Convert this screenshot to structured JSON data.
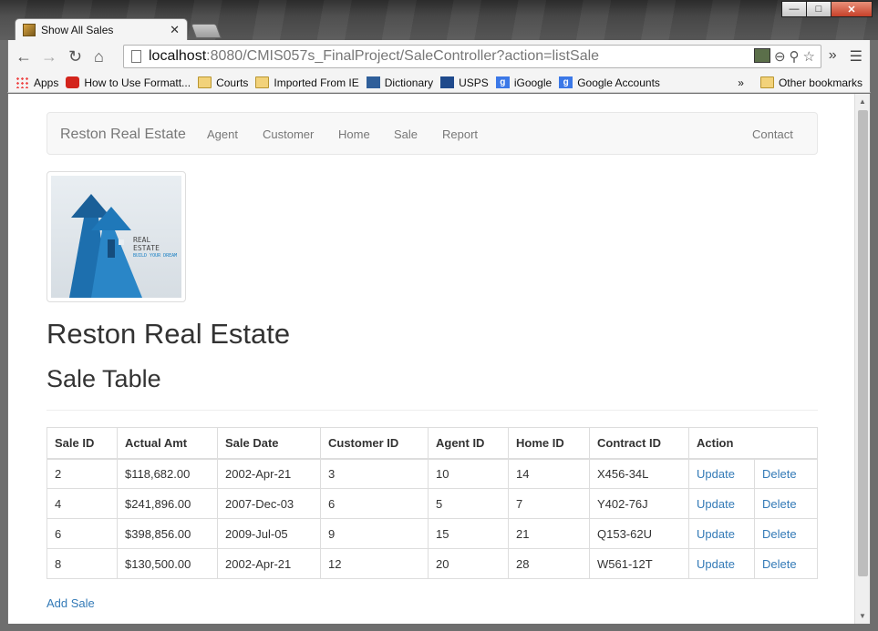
{
  "browser": {
    "tab_title": "Show All Sales",
    "url_host": "localhost",
    "url_rest": ":8080/CMIS057s_FinalProject/SaleController?action=listSale",
    "bookmarks": [
      "Apps",
      "How to Use Formatt...",
      "Courts",
      "Imported From IE",
      "Dictionary",
      "USPS",
      "iGoogle",
      "Google Accounts"
    ],
    "other_bookmarks": "Other bookmarks",
    "overflow": "»"
  },
  "navbar": {
    "brand": "Reston Real Estate",
    "links": [
      "Agent",
      "Customer",
      "Home",
      "Sale",
      "Report"
    ],
    "contact": "Contact"
  },
  "logo": {
    "line1": "REAL",
    "line2": "ESTATE",
    "line3": "BUILD YOUR DREAM"
  },
  "page": {
    "title": "Reston Real Estate",
    "subtitle": "Sale Table",
    "add_link": "Add Sale"
  },
  "table": {
    "headers": [
      "Sale ID",
      "Actual Amt",
      "Sale Date",
      "Customer ID",
      "Agent ID",
      "Home ID",
      "Contract ID",
      "Action"
    ],
    "rows": [
      [
        "2",
        "$118,682.00",
        "2002-Apr-21",
        "3",
        "10",
        "14",
        "X456-34L"
      ],
      [
        "4",
        "$241,896.00",
        "2007-Dec-03",
        "6",
        "5",
        "7",
        "Y402-76J"
      ],
      [
        "6",
        "$398,856.00",
        "2009-Jul-05",
        "9",
        "15",
        "21",
        "Q153-62U"
      ],
      [
        "8",
        "$130,500.00",
        "2002-Apr-21",
        "12",
        "20",
        "28",
        "W561-12T"
      ]
    ],
    "update_label": "Update",
    "delete_label": "Delete"
  },
  "colors": {
    "link": "#337ab7",
    "navbar_bg": "#f8f8f8",
    "text": "#333333"
  }
}
